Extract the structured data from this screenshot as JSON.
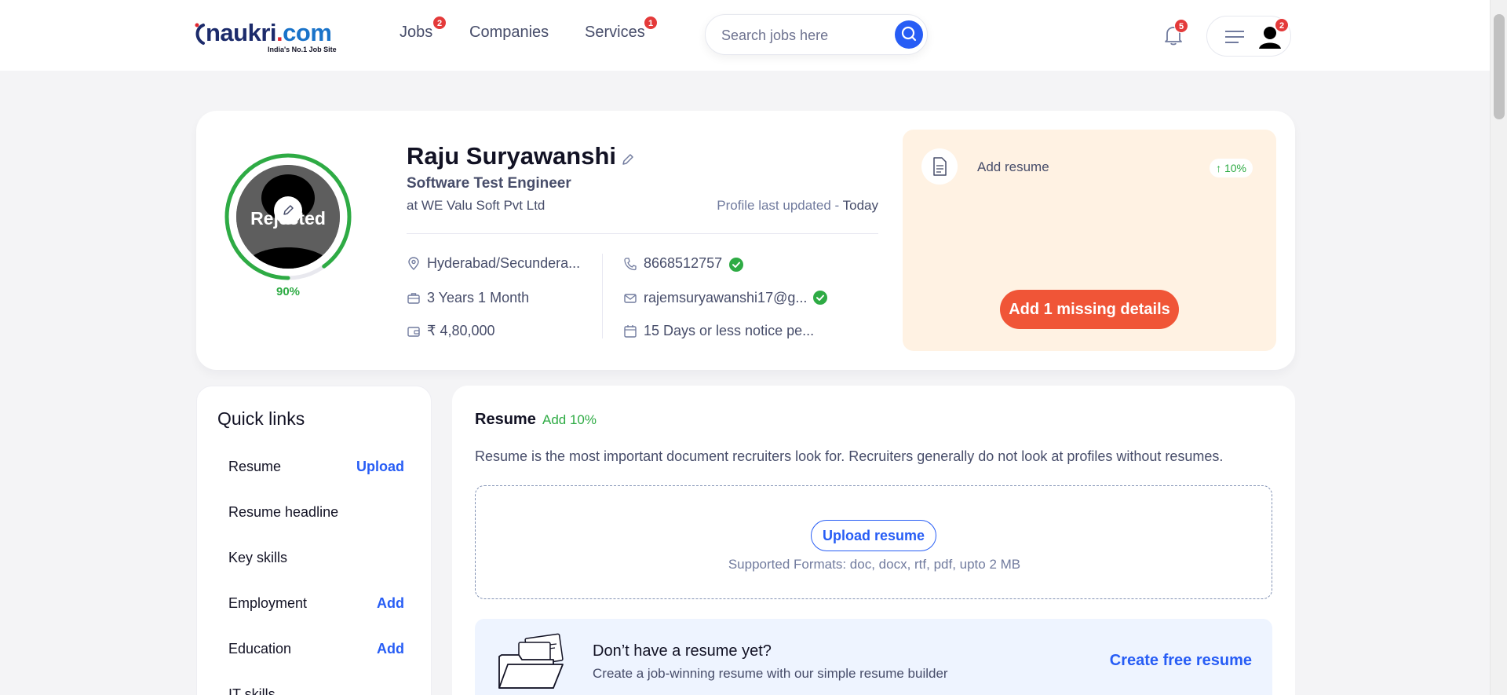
{
  "header": {
    "logo_text_main": "naukri",
    "logo_text_dot": ".",
    "logo_text_com": "com",
    "logo_tagline": "India's No.1 Job Site",
    "nav": [
      {
        "label": "Jobs",
        "badge": "2"
      },
      {
        "label": "Companies",
        "badge": ""
      },
      {
        "label": "Services",
        "badge": "1"
      }
    ],
    "search_placeholder": "Search jobs here",
    "notification_badge": "5",
    "profile_badge": "2"
  },
  "profile": {
    "status_overlay": "Rejected",
    "completion": "90%",
    "name": "Raju Suryawanshi",
    "designation": "Software Test Engineer",
    "company": "at WE Valu Soft Pvt Ltd",
    "updated_label": "Profile last updated - ",
    "updated_value": "Today",
    "location": "Hyderabad/Secundera...",
    "experience": "3 Years 1 Month",
    "salary": "₹ 4,80,000",
    "phone": "8668512757",
    "email": "rajemsuryawanshi17@g...",
    "notice": "15 Days or less notice pe..."
  },
  "missing": {
    "item_label": "Add resume",
    "item_boost": "↑ 10%",
    "button_label": "Add 1 missing details"
  },
  "quick_links": {
    "title": "Quick links",
    "items": [
      {
        "label": "Resume",
        "action": "Upload"
      },
      {
        "label": "Resume headline",
        "action": ""
      },
      {
        "label": "Key skills",
        "action": ""
      },
      {
        "label": "Employment",
        "action": "Add"
      },
      {
        "label": "Education",
        "action": "Add"
      },
      {
        "label": "IT skills",
        "action": ""
      }
    ]
  },
  "resume": {
    "title": "Resume",
    "add_label": "Add 10%",
    "description": "Resume is the most important document recruiters look for. Recruiters generally do not look at profiles without resumes.",
    "upload_button": "Upload resume",
    "formats": "Supported Formats: doc, docx, rtf, pdf, upto 2 MB",
    "builder_title": "Don’t have a resume yet?",
    "builder_subtitle": "Create a job-winning resume with our simple resume builder",
    "builder_cta": "Create free resume"
  },
  "colors": {
    "accent": "#275df5",
    "success": "#2eab44",
    "cta": "#f05537",
    "badge": "#e43a3a"
  },
  "icons": [
    "search-icon",
    "bell-icon",
    "hamburger-icon",
    "user-icon",
    "pencil-icon",
    "location-icon",
    "briefcase-icon",
    "wallet-icon",
    "phone-icon",
    "mail-icon",
    "calendar-icon",
    "verified-icon",
    "document-icon"
  ]
}
